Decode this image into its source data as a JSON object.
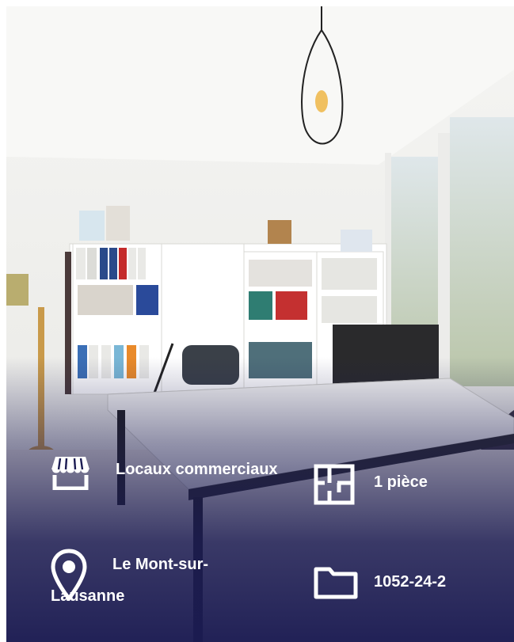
{
  "listing": {
    "property_type": "Locaux commerciaux",
    "location": "Le Mont-sur-Lausanne",
    "rooms": "1 pièce",
    "reference": "1052-24-2"
  },
  "icons": {
    "property_type": "storefront-icon",
    "location": "map-pin-icon",
    "rooms": "floor-plan-icon",
    "reference": "folder-icon"
  },
  "colors": {
    "overlay": "#1b1b52",
    "text": "#ffffff"
  }
}
